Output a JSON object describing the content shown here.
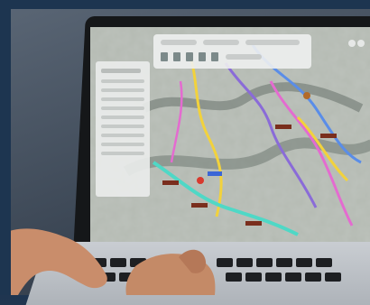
{
  "scene": {
    "subject": "laptop-showing-topographic-trail-map",
    "colors": {
      "background": "#1f3550",
      "laptop_body": "#151719",
      "keyboard_deck": "#c2c6cb",
      "route_yellow": "#f2d23c",
      "route_purple": "#8a6bd8",
      "route_blue": "#5a8de8",
      "route_cyan": "#4fd8c6",
      "route_pink": "#e46bd0",
      "marker_red": "#d83a2e",
      "terrain": "#aeb4ad"
    },
    "icons": [
      "map-pin-icon",
      "trail-label-icon",
      "layer-panel-icon"
    ]
  }
}
